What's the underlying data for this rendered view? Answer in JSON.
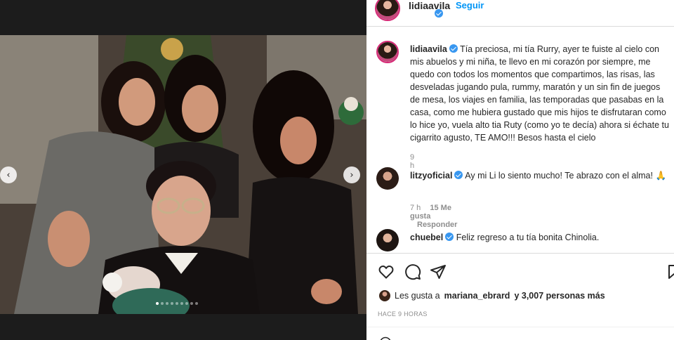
{
  "post": {
    "author": "lidiaavila",
    "follow_label": "Seguir",
    "dot_sep": "•",
    "caption": "Tía preciosa, mi tía Rurry, ayer te fuiste al cielo con mis abuelos y mi niña, te llevo en mi corazón por siempre, me quedo con todos los momentos que compartimos, las risas, las desveladas jugando pula, rummy, maratón y un sin fin de juegos de mesa, los viajes en familia, las temporadas que pasabas en la casa, como me hubiera gustado que mis hijos te disfrutaran como lo hice yo, vuela alto tia Ruty (como yo te decía) ahora si échate tu cigarrito agusto, TE AMO!!! Besos hasta el cielo",
    "caption_time": "9 h"
  },
  "comments": [
    {
      "user": "litzyoficial",
      "text": "Ay mi Li lo siento mucho! Te abrazo con el alma! 🙏",
      "time": "7 h",
      "likes": "15 Me gusta",
      "reply": "Responder"
    },
    {
      "user": "chuebel",
      "text": "Feliz regreso a tu tía bonita Chinolia."
    }
  ],
  "likes": {
    "prefix": "Les gusta a",
    "user": "mariana_ebrard",
    "suffix": "y 3,007 personas más"
  },
  "posted_ago": "HACE 9 HORAS",
  "carousel": {
    "count": 9,
    "active": 0
  },
  "icons": {
    "nav_prev": "chevron-left-icon",
    "nav_next": "chevron-right-icon",
    "like": "heart-icon",
    "comment": "comment-icon",
    "share": "paper-plane-icon",
    "save": "bookmark-icon",
    "emoji": "smile-icon"
  },
  "colors": {
    "link": "#0095f6",
    "verified": "#3897f0",
    "muted": "#8e8e8e"
  }
}
